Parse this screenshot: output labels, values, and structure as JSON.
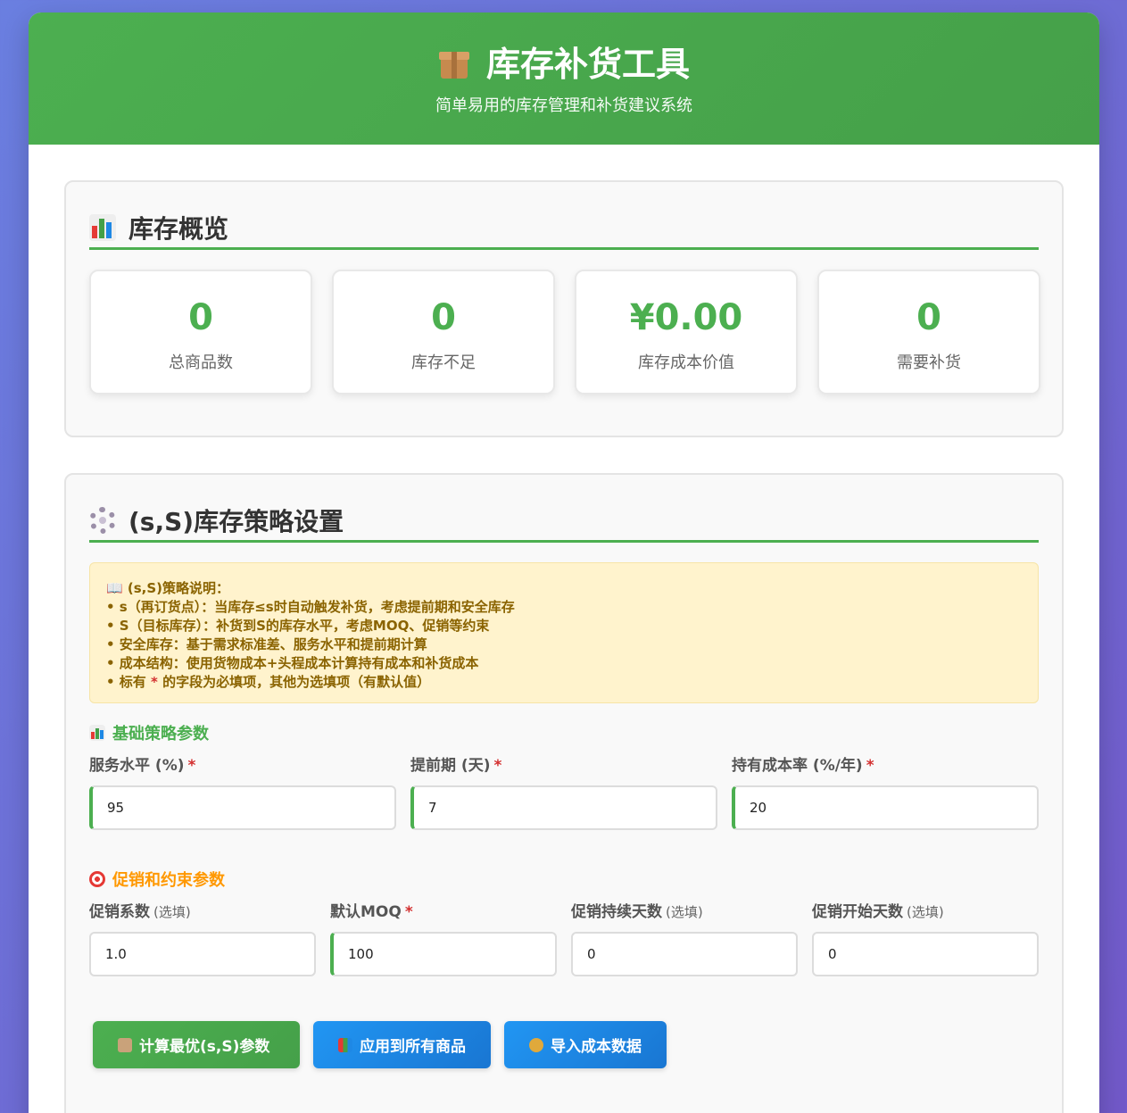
{
  "header": {
    "title": "库存补货工具",
    "subtitle": "简单易用的库存管理和补货建议系统"
  },
  "overview": {
    "title": "库存概览",
    "stats": [
      {
        "value": "0",
        "label": "总商品数"
      },
      {
        "value": "0",
        "label": "库存不足"
      },
      {
        "value": "¥0.00",
        "label": "库存成本价值"
      },
      {
        "value": "0",
        "label": "需要补货"
      }
    ]
  },
  "strategy": {
    "title": "(s,S)库存策略设置",
    "note": {
      "heading": "📖 (s,S)策略说明：",
      "lines": [
        "• s（再订货点）：当库存≤s时自动触发补货，考虑提前期和安全库存",
        "• S（目标库存）：补货到S的库存水平，考虑MOQ、促销等约束",
        "• 安全库存：基于需求标准差、服务水平和提前期计算",
        "• 成本结构：使用货物成本+头程成本计算持有成本和补货成本"
      ],
      "last_prefix": "• 标有 ",
      "last_star": "*",
      "last_suffix": " 的字段为必填项，其他为选填项（有默认值）"
    },
    "basic": {
      "title": "基础策略参数",
      "fields": [
        {
          "label": "服务水平 (%)",
          "value": "95"
        },
        {
          "label": "提前期 (天)",
          "value": "7"
        },
        {
          "label": "持有成本率 (%/年)",
          "value": "20"
        }
      ],
      "required_mark": "*"
    },
    "promo": {
      "title": "促销和约束参数",
      "optional_text": "(选填)",
      "fields": [
        {
          "label": "促销系数",
          "value": "1.0"
        },
        {
          "label": "默认MOQ",
          "value": "100"
        },
        {
          "label": "促销持续天数",
          "value": "0"
        },
        {
          "label": "促销开始天数",
          "value": "0"
        }
      ]
    },
    "buttons": {
      "calc": "计算最优(s,S)参数",
      "apply": "应用到所有商品",
      "import": "导入成本数据"
    }
  }
}
